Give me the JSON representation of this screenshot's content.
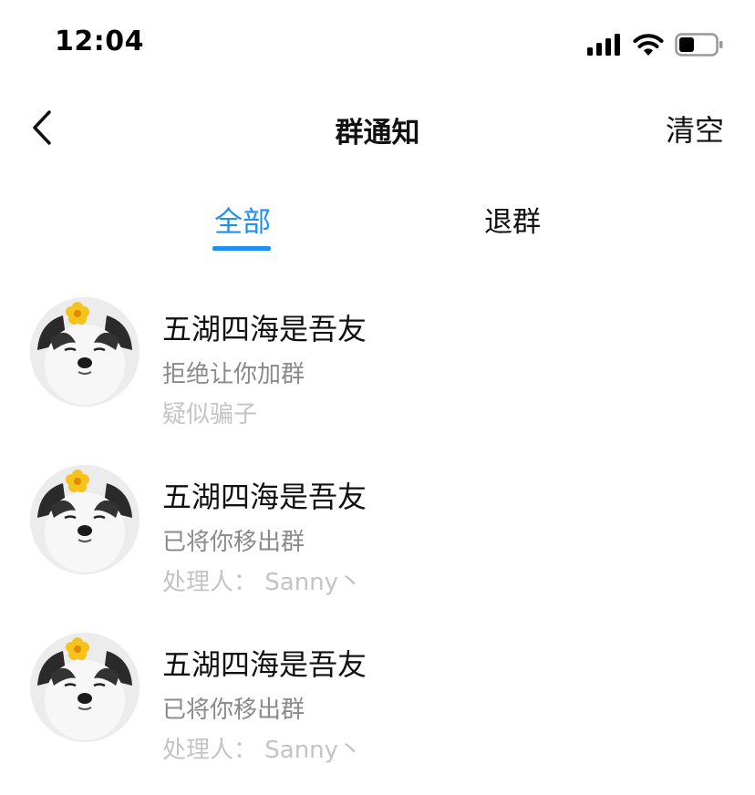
{
  "status_bar": {
    "time": "12:04"
  },
  "nav": {
    "title": "群通知",
    "clear_label": "清空"
  },
  "tabs": [
    {
      "label": "全部",
      "active": true
    },
    {
      "label": "退群",
      "active": false
    }
  ],
  "notifications": [
    {
      "group_name": "五湖四海是吾友",
      "action": "拒绝让你加群",
      "detail": "疑似骗子"
    },
    {
      "group_name": "五湖四海是吾友",
      "action": "已将你移出群",
      "detail": "处理人： Sanny丶"
    },
    {
      "group_name": "五湖四海是吾友",
      "action": "已将你移出群",
      "detail": "处理人： Sanny丶"
    }
  ],
  "colors": {
    "accent": "#1e8ff5",
    "secondary_text": "#8a8a8a",
    "tertiary_text": "#c4c4c4"
  }
}
